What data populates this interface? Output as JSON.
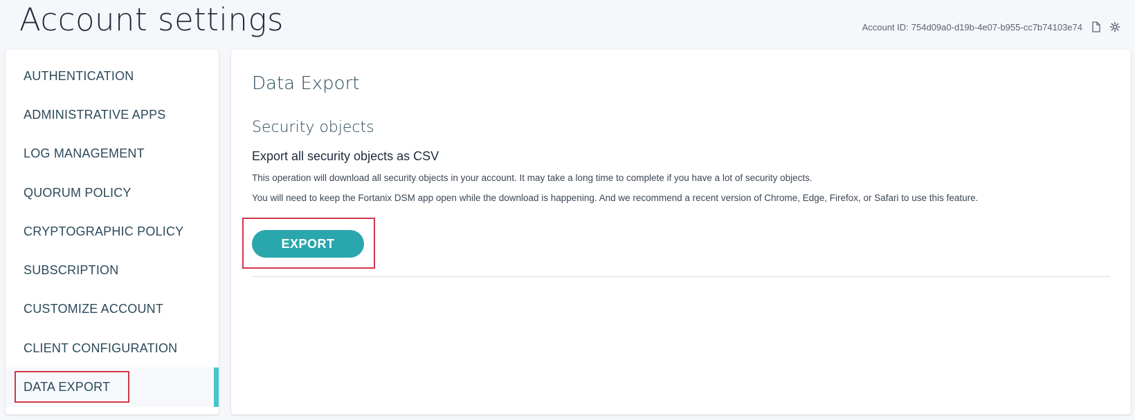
{
  "page": {
    "title": "Account settings"
  },
  "account": {
    "id_label": "Account ID:",
    "id_value": "754d09a0-d19b-4e07-b955-cc7b74103e74",
    "copy_icon": "copy-icon",
    "settings_icon": "gear-icon"
  },
  "sidebar": {
    "items": [
      {
        "label": "AUTHENTICATION"
      },
      {
        "label": "ADMINISTRATIVE APPS"
      },
      {
        "label": "LOG MANAGEMENT"
      },
      {
        "label": "QUORUM POLICY"
      },
      {
        "label": "CRYPTOGRAPHIC POLICY"
      },
      {
        "label": "SUBSCRIPTION"
      },
      {
        "label": "CUSTOMIZE ACCOUNT"
      },
      {
        "label": "CLIENT CONFIGURATION"
      },
      {
        "label": "DATA EXPORT",
        "active": true
      }
    ],
    "active_color": "#46c6c9"
  },
  "main": {
    "title": "Data Export",
    "section_title": "Security objects",
    "export_heading": "Export all security objects as CSV",
    "description_1": "This operation will download all security objects in your account. It may take a long time to complete if you have a lot of security objects.",
    "description_2": "You will need to keep the Fortanix DSM app open while the download is happening. And we recommend a recent version of Chrome, Edge, Firefox, or Safari to use this feature.",
    "export_button": "EXPORT",
    "button_color": "#2aa6ad",
    "highlight_color": "#d0364a"
  }
}
